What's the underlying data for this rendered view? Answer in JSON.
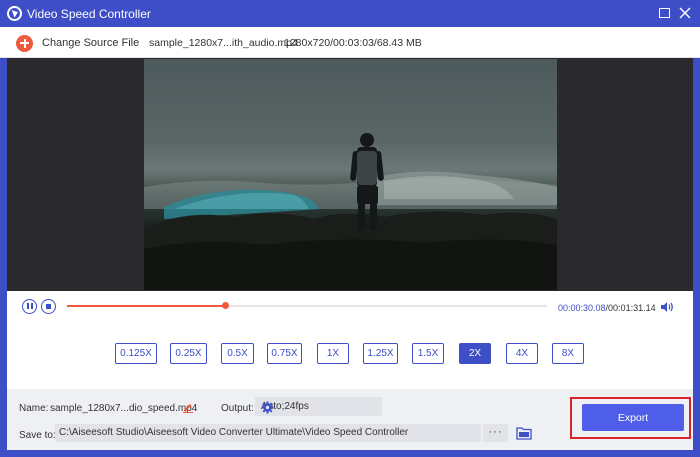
{
  "window": {
    "title": "Video Speed Controller",
    "maximize_icon": "maximize-icon",
    "close_icon": "close-icon"
  },
  "source": {
    "button_label": "Change Source File",
    "file_name": "sample_1280x7...ith_audio.mp4",
    "file_meta": "1280x720/00:03:03/68.43 MB"
  },
  "player": {
    "current_time": "00:00:30.08",
    "total_time": "/00:01:31.14",
    "progress_fraction": 0.33
  },
  "speeds": {
    "options": [
      "0.125X",
      "0.25X",
      "0.5X",
      "0.75X",
      "1X",
      "1.25X",
      "1.5X",
      "2X",
      "4X",
      "8X"
    ],
    "selected": "2X"
  },
  "settings": {
    "name_label": "Name:",
    "name_value": "sample_1280x7...dio_speed.mp4",
    "output_label": "Output:",
    "output_value": "Auto;24fps",
    "save_label": "Save to:",
    "save_path": "C:\\Aiseesoft Studio\\Aiseesoft Video Converter Ultimate\\Video Speed Controller",
    "more_label": "···"
  },
  "export": {
    "label": "Export"
  },
  "colors": {
    "accent": "#3d4ec7",
    "progress": "#f05a3c",
    "export": "#4f5ee8",
    "highlight": "#d9242a"
  }
}
